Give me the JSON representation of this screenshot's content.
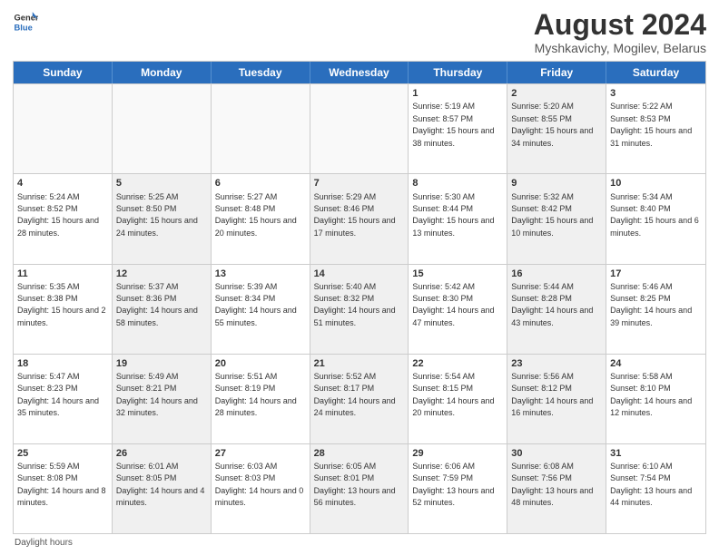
{
  "header": {
    "title": "August 2024",
    "location": "Myshkavichy, Mogilev, Belarus",
    "logo_line1": "General",
    "logo_line2": "Blue"
  },
  "calendar": {
    "days_of_week": [
      "Sunday",
      "Monday",
      "Tuesday",
      "Wednesday",
      "Thursday",
      "Friday",
      "Saturday"
    ],
    "rows": [
      [
        {
          "num": "",
          "data": "",
          "shaded": false,
          "empty": true
        },
        {
          "num": "",
          "data": "",
          "shaded": false,
          "empty": true
        },
        {
          "num": "",
          "data": "",
          "shaded": false,
          "empty": true
        },
        {
          "num": "",
          "data": "",
          "shaded": false,
          "empty": true
        },
        {
          "num": "1",
          "data": "Sunrise: 5:19 AM\nSunset: 8:57 PM\nDaylight: 15 hours and 38 minutes.",
          "shaded": false,
          "empty": false
        },
        {
          "num": "2",
          "data": "Sunrise: 5:20 AM\nSunset: 8:55 PM\nDaylight: 15 hours and 34 minutes.",
          "shaded": true,
          "empty": false
        },
        {
          "num": "3",
          "data": "Sunrise: 5:22 AM\nSunset: 8:53 PM\nDaylight: 15 hours and 31 minutes.",
          "shaded": false,
          "empty": false
        }
      ],
      [
        {
          "num": "4",
          "data": "Sunrise: 5:24 AM\nSunset: 8:52 PM\nDaylight: 15 hours and 28 minutes.",
          "shaded": false,
          "empty": false
        },
        {
          "num": "5",
          "data": "Sunrise: 5:25 AM\nSunset: 8:50 PM\nDaylight: 15 hours and 24 minutes.",
          "shaded": true,
          "empty": false
        },
        {
          "num": "6",
          "data": "Sunrise: 5:27 AM\nSunset: 8:48 PM\nDaylight: 15 hours and 20 minutes.",
          "shaded": false,
          "empty": false
        },
        {
          "num": "7",
          "data": "Sunrise: 5:29 AM\nSunset: 8:46 PM\nDaylight: 15 hours and 17 minutes.",
          "shaded": true,
          "empty": false
        },
        {
          "num": "8",
          "data": "Sunrise: 5:30 AM\nSunset: 8:44 PM\nDaylight: 15 hours and 13 minutes.",
          "shaded": false,
          "empty": false
        },
        {
          "num": "9",
          "data": "Sunrise: 5:32 AM\nSunset: 8:42 PM\nDaylight: 15 hours and 10 minutes.",
          "shaded": true,
          "empty": false
        },
        {
          "num": "10",
          "data": "Sunrise: 5:34 AM\nSunset: 8:40 PM\nDaylight: 15 hours and 6 minutes.",
          "shaded": false,
          "empty": false
        }
      ],
      [
        {
          "num": "11",
          "data": "Sunrise: 5:35 AM\nSunset: 8:38 PM\nDaylight: 15 hours and 2 minutes.",
          "shaded": false,
          "empty": false
        },
        {
          "num": "12",
          "data": "Sunrise: 5:37 AM\nSunset: 8:36 PM\nDaylight: 14 hours and 58 minutes.",
          "shaded": true,
          "empty": false
        },
        {
          "num": "13",
          "data": "Sunrise: 5:39 AM\nSunset: 8:34 PM\nDaylight: 14 hours and 55 minutes.",
          "shaded": false,
          "empty": false
        },
        {
          "num": "14",
          "data": "Sunrise: 5:40 AM\nSunset: 8:32 PM\nDaylight: 14 hours and 51 minutes.",
          "shaded": true,
          "empty": false
        },
        {
          "num": "15",
          "data": "Sunrise: 5:42 AM\nSunset: 8:30 PM\nDaylight: 14 hours and 47 minutes.",
          "shaded": false,
          "empty": false
        },
        {
          "num": "16",
          "data": "Sunrise: 5:44 AM\nSunset: 8:28 PM\nDaylight: 14 hours and 43 minutes.",
          "shaded": true,
          "empty": false
        },
        {
          "num": "17",
          "data": "Sunrise: 5:46 AM\nSunset: 8:25 PM\nDaylight: 14 hours and 39 minutes.",
          "shaded": false,
          "empty": false
        }
      ],
      [
        {
          "num": "18",
          "data": "Sunrise: 5:47 AM\nSunset: 8:23 PM\nDaylight: 14 hours and 35 minutes.",
          "shaded": false,
          "empty": false
        },
        {
          "num": "19",
          "data": "Sunrise: 5:49 AM\nSunset: 8:21 PM\nDaylight: 14 hours and 32 minutes.",
          "shaded": true,
          "empty": false
        },
        {
          "num": "20",
          "data": "Sunrise: 5:51 AM\nSunset: 8:19 PM\nDaylight: 14 hours and 28 minutes.",
          "shaded": false,
          "empty": false
        },
        {
          "num": "21",
          "data": "Sunrise: 5:52 AM\nSunset: 8:17 PM\nDaylight: 14 hours and 24 minutes.",
          "shaded": true,
          "empty": false
        },
        {
          "num": "22",
          "data": "Sunrise: 5:54 AM\nSunset: 8:15 PM\nDaylight: 14 hours and 20 minutes.",
          "shaded": false,
          "empty": false
        },
        {
          "num": "23",
          "data": "Sunrise: 5:56 AM\nSunset: 8:12 PM\nDaylight: 14 hours and 16 minutes.",
          "shaded": true,
          "empty": false
        },
        {
          "num": "24",
          "data": "Sunrise: 5:58 AM\nSunset: 8:10 PM\nDaylight: 14 hours and 12 minutes.",
          "shaded": false,
          "empty": false
        }
      ],
      [
        {
          "num": "25",
          "data": "Sunrise: 5:59 AM\nSunset: 8:08 PM\nDaylight: 14 hours and 8 minutes.",
          "shaded": false,
          "empty": false
        },
        {
          "num": "26",
          "data": "Sunrise: 6:01 AM\nSunset: 8:05 PM\nDaylight: 14 hours and 4 minutes.",
          "shaded": true,
          "empty": false
        },
        {
          "num": "27",
          "data": "Sunrise: 6:03 AM\nSunset: 8:03 PM\nDaylight: 14 hours and 0 minutes.",
          "shaded": false,
          "empty": false
        },
        {
          "num": "28",
          "data": "Sunrise: 6:05 AM\nSunset: 8:01 PM\nDaylight: 13 hours and 56 minutes.",
          "shaded": true,
          "empty": false
        },
        {
          "num": "29",
          "data": "Sunrise: 6:06 AM\nSunset: 7:59 PM\nDaylight: 13 hours and 52 minutes.",
          "shaded": false,
          "empty": false
        },
        {
          "num": "30",
          "data": "Sunrise: 6:08 AM\nSunset: 7:56 PM\nDaylight: 13 hours and 48 minutes.",
          "shaded": true,
          "empty": false
        },
        {
          "num": "31",
          "data": "Sunrise: 6:10 AM\nSunset: 7:54 PM\nDaylight: 13 hours and 44 minutes.",
          "shaded": false,
          "empty": false
        }
      ]
    ]
  },
  "footer": {
    "note": "Daylight hours"
  }
}
